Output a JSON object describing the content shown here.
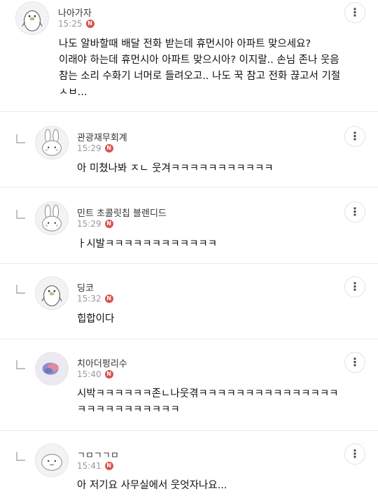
{
  "comments": [
    {
      "author": "나아가자",
      "time": "15:25",
      "badge": "N",
      "avatar": "penguin-avatar",
      "text": "나도 알바할때 배달 전화 받는데 휴먼시아 아파트 맞으세요?\n이래야 하는데 휴먼시아 아파트 맞으시아? 이지랄.. 손님 존나 웃음\n참는 소리 수화기 너머로 들려오고.. 나도 꾹 참고 전화 끊고서 기절\nㅅㅂ..."
    },
    {
      "author": "관광재무회계",
      "time": "15:29",
      "badge": "N",
      "avatar": "rabbit-avatar",
      "text": "아 미쳤나봐 ㅈㄴ 웃겨ㅋㅋㅋㅋㅋㅋㅋㅋㅋㅋㅋ"
    },
    {
      "author": "민트 초콜릿칩 블렌디드",
      "time": "15:29",
      "badge": "N",
      "avatar": "rabbit-avatar",
      "text": "ㅏ시발ㅋㅋㅋㅋㅋㅋㅋㅋㅋㅋㅋㅋ"
    },
    {
      "author": "딩코",
      "time": "15:32",
      "badge": "N",
      "avatar": "penguin-avatar",
      "text": "힙합이다"
    },
    {
      "author": "치아더펑리수",
      "time": "15:40",
      "badge": "N",
      "avatar": "photo-avatar",
      "text": "시박ㅋㅋㅋㅋㅋㅋ존ㄴ나웃겪ㅋㅋㅋㅋㅋㅋㅋㅋㅋㅋㅋㅋㅋㅋㅋ\nㅋㅋㅋㅋㅋㅋㅋㅋㅋㅋㅋ"
    },
    {
      "author": "ㄱㅁㄱㄱㅁ",
      "time": "15:41",
      "badge": "N",
      "avatar": "blob-avatar",
      "text": "아 저기요 사무실에서 웃엇자나요..."
    }
  ],
  "more_icon": "⋮"
}
